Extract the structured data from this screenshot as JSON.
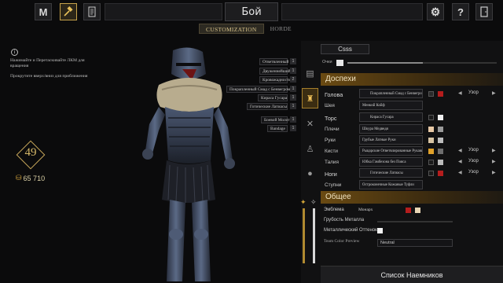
{
  "topbar": {
    "logo_label": "M",
    "title": "Бой",
    "help_label": "?"
  },
  "tabs": [
    {
      "label": "Customization",
      "active": true
    },
    {
      "label": "Horde",
      "active": false
    }
  ],
  "hints": {
    "line1": "Нажимайте и Перетаскивайте ЛКМ для вращения",
    "line2": "Прокрутите вверх/вниз для приближения"
  },
  "player": {
    "level": "49",
    "gold": "65 710"
  },
  "equipped": [
    {
      "label": "Ответвленный",
      "num": "1"
    },
    {
      "label": "Двуженнейший",
      "num": "1"
    },
    {
      "label": "Кровожадность",
      "num": "2"
    },
    {
      "label": "Покрапленный Смад с Бенвегром",
      "num": "1"
    },
    {
      "label": "Кираса Гусара",
      "num": "1"
    },
    {
      "label": "Готические Латиасы",
      "num": "1"
    },
    {
      "label": "Боевой Молот",
      "num": "1"
    },
    {
      "label": "Bandage",
      "num": "1"
    }
  ],
  "panel": {
    "preset_name": "Csss",
    "glasses_label": "Очки",
    "armor_header": "Доспехи",
    "general_header": "Общее",
    "rows": [
      {
        "label": "Голова",
        "item": "Покрапленный Смад с Бенвегром",
        "icon": true,
        "big": true,
        "colors": [
          "#2b2b2b",
          "#b51d1d"
        ],
        "pattern": "Узор"
      },
      {
        "label": "Шея",
        "item": "Менкий Койф",
        "icon": false,
        "big": false,
        "colors": [],
        "pattern": ""
      },
      {
        "label": "Торс",
        "item": "Кираса Гусара",
        "icon": true,
        "big": true,
        "colors": [
          "#1a1a1a",
          "#f0f0f0"
        ],
        "pattern": ""
      },
      {
        "label": "Плечи",
        "item": "Шкура Медведя",
        "icon": false,
        "big": false,
        "colors": [
          "#e8c9a6",
          "#9a9a9a"
        ],
        "pattern": ""
      },
      {
        "label": "Руки",
        "item": "Грубые Латные Руки",
        "icon": false,
        "big": false,
        "colors": [
          "#d7c4a4",
          "#bdbdbd"
        ],
        "pattern": ""
      },
      {
        "label": "Кисти",
        "item": "Рыцарские Ответвлированные Рукавицы",
        "icon": false,
        "big": false,
        "colors": [
          "#e0a12a",
          "#6e6e6e"
        ],
        "pattern": "Узор"
      },
      {
        "label": "Талия",
        "item": "Юбка Гамбезона без Пояса",
        "icon": false,
        "big": false,
        "colors": [
          "#1a1a1a",
          "#bbbbbb"
        ],
        "pattern": "Узор"
      },
      {
        "label": "Ноги",
        "item": "Готические Латиасы",
        "icon": true,
        "big": true,
        "colors": [
          "#1a1a1a",
          "#b51d1d"
        ],
        "pattern": "Узор"
      },
      {
        "label": "Ступни",
        "item": "Остроконечные Кожаные Туфли",
        "icon": false,
        "big": false,
        "colors": [],
        "pattern": ""
      }
    ],
    "emblem_label": "Эмблема",
    "emblem_value": "Монарх",
    "metal_rough_label": "Грубость Металла",
    "metal_tint_label": "Металлический Оттенок",
    "team_color_label": "Team Color Preview",
    "team_color_value": "Neutral",
    "mercs_button": "Список Наемников"
  },
  "colors": {
    "accent": "#c6a24a",
    "section_gradient": "#6a4a12"
  }
}
